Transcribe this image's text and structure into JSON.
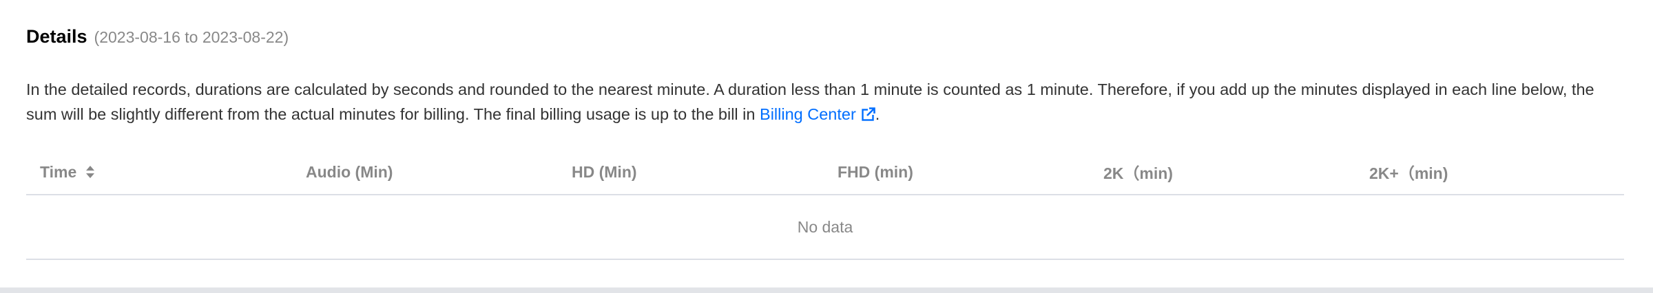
{
  "details": {
    "title": "Details",
    "date_range": "(2023-08-16 to 2023-08-22)"
  },
  "description": {
    "text": "In the detailed records, durations are calculated by seconds and rounded to the nearest minute. A duration less than 1 minute is counted as 1 minute. Therefore, if you add up the minutes displayed in each line below, the sum will be slightly different from the actual minutes for billing. The final billing usage is up to the bill in ",
    "link_label": "Billing Center",
    "suffix": "."
  },
  "table": {
    "columns": [
      {
        "label": "Time",
        "sortable": true
      },
      {
        "label": "Audio (Min)"
      },
      {
        "label": "HD (Min)"
      },
      {
        "label": "FHD (min)"
      },
      {
        "label": "2K（min)"
      },
      {
        "label": "2K+（min)"
      }
    ],
    "empty_text": "No data"
  },
  "colors": {
    "link": "#006eff",
    "muted": "#888888",
    "border": "#dcdfe6"
  },
  "icons": {
    "sort": "sort-icon",
    "external_link": "external-link-icon"
  }
}
